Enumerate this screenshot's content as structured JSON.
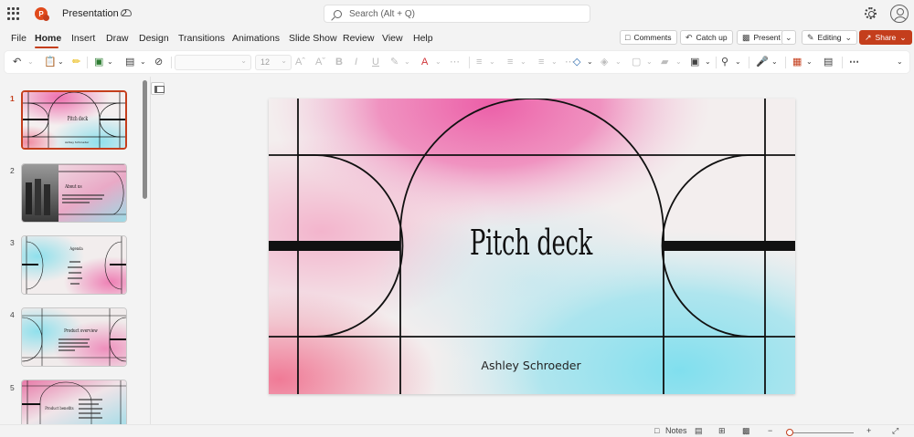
{
  "window": {
    "doc_title": "Presentation 2",
    "search_placeholder": "Search (Alt + Q)"
  },
  "menu": {
    "tabs": [
      {
        "label": "File"
      },
      {
        "label": "Home"
      },
      {
        "label": "Insert"
      },
      {
        "label": "Draw"
      },
      {
        "label": "Design"
      },
      {
        "label": "Transitions"
      },
      {
        "label": "Animations"
      },
      {
        "label": "Slide Show"
      },
      {
        "label": "Review"
      },
      {
        "label": "View"
      },
      {
        "label": "Help"
      }
    ],
    "active_tab": "Home"
  },
  "commands": {
    "comments": "Comments",
    "catch_up": "Catch up",
    "present": "Present",
    "editing": "Editing",
    "share": "Share"
  },
  "ribbon": {
    "font_size": "12"
  },
  "slides": [
    {
      "number": "1",
      "title": "Pitch deck",
      "subtitle": "Ashley Schroeder"
    },
    {
      "number": "2",
      "title": "About us"
    },
    {
      "number": "3",
      "title": "Agenda"
    },
    {
      "number": "4",
      "title": "Product overview"
    },
    {
      "number": "5",
      "title": "Product benefits"
    }
  ],
  "current_slide": {
    "title": "Pitch deck",
    "subtitle": "Ashley Schroeder"
  },
  "status": {
    "notes_label": "Notes"
  },
  "colors": {
    "accent": "#c43e1c",
    "slide_pink": "#ee6fae",
    "slide_cyan": "#8fe0ec"
  }
}
